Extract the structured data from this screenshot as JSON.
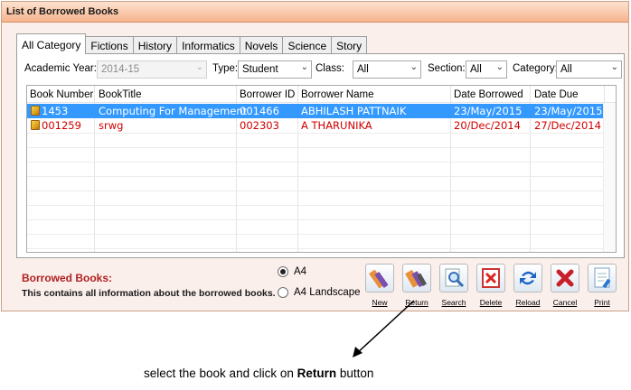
{
  "window": {
    "title": "List of Borrowed Books"
  },
  "tabs": [
    "All Category",
    "Fictions",
    "History",
    "Informatics",
    "Novels",
    "Science",
    "Story"
  ],
  "filters": {
    "year_label": "Academic Year:",
    "year_value": "2014-15",
    "type_label": "Type:",
    "type_value": "Student",
    "class_label": "Class:",
    "class_value": "All",
    "section_label": "Section:",
    "section_value": "All",
    "category_label": "Category:",
    "category_value": "All"
  },
  "table": {
    "columns": [
      "Book Number",
      "BookTitle",
      "Borrower ID",
      "Borrower Name",
      "Date Borrowed",
      "Date Due"
    ],
    "rows": [
      {
        "book_number": "1453",
        "title": "Computing For Management",
        "borrower_id": "001466",
        "borrower_name": "ABHILASH PATTNAIK",
        "date_borrowed": "23/May/2015",
        "date_due": "23/May/2015",
        "selected": true,
        "overdue": false
      },
      {
        "book_number": "001259",
        "title": "srwg",
        "borrower_id": "002303",
        "borrower_name": "A THARUNIKA",
        "date_borrowed": "20/Dec/2014",
        "date_due": "27/Dec/2014",
        "selected": false,
        "overdue": true
      }
    ]
  },
  "footer": {
    "title": "Borrowed Books:",
    "description": "This contains all information about the borrowed books."
  },
  "paper": {
    "a4": "A4",
    "a4_landscape": "A4 Landscape",
    "selected": "A4"
  },
  "toolbar": {
    "new": "New",
    "return": "Return",
    "search": "Search",
    "delete": "Delete",
    "reload": "Reload",
    "cancel": "Cancel",
    "print": "Print"
  },
  "annotation": {
    "prefix": "select the book and click on ",
    "emphasis": "Return",
    "suffix": " button"
  },
  "colors": {
    "selection": "#3399ff",
    "overdue": "#d00000",
    "footer_title": "#b02020",
    "title_gradient_end": "#f6b48d"
  }
}
